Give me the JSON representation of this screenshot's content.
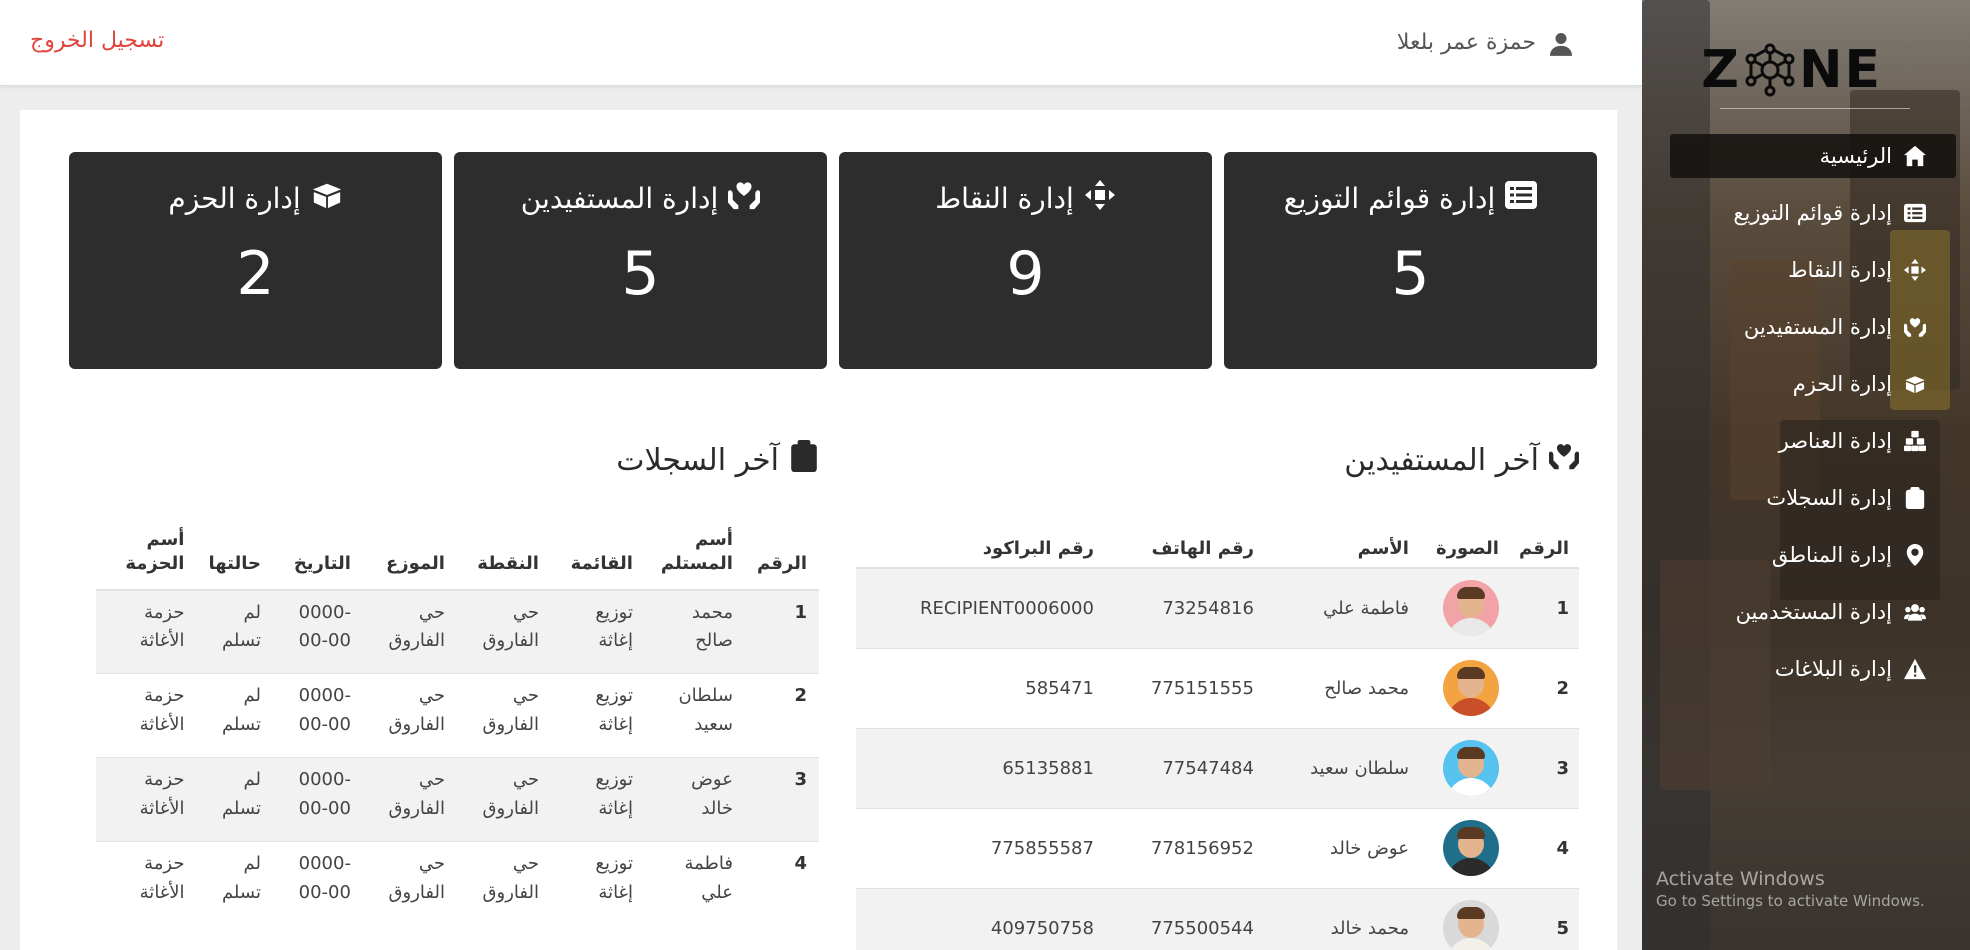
{
  "topbar": {
    "logout": "تسجيل الخروج",
    "user_name": "حمزة عمر بلعلا"
  },
  "sidebar": {
    "logo_left": "Z",
    "logo_right": "NE",
    "items": [
      {
        "label": "الرئيسية",
        "icon": "home-icon"
      },
      {
        "label": "إدارة قوائم التوزيع",
        "icon": "list-icon"
      },
      {
        "label": "إدارة النقاط",
        "icon": "points-icon"
      },
      {
        "label": "إدارة المستفيدين",
        "icon": "hands-icon"
      },
      {
        "label": "إدارة الحزم",
        "icon": "box-icon"
      },
      {
        "label": "إدارة العناصر",
        "icon": "items-icon"
      },
      {
        "label": "إدارة السجلات",
        "icon": "clipboard-icon"
      },
      {
        "label": "إدارة المناطق",
        "icon": "location-icon"
      },
      {
        "label": "إدارة المستخدمين",
        "icon": "users-icon"
      },
      {
        "label": "إدارة البلاغات",
        "icon": "warning-icon"
      }
    ]
  },
  "stats": [
    {
      "title": "إدارة قوائم التوزيع",
      "value": "5",
      "icon": "list-icon"
    },
    {
      "title": "إدارة النقاط",
      "value": "9",
      "icon": "points-icon"
    },
    {
      "title": "إدارة المستفيدين",
      "value": "5",
      "icon": "hands-icon"
    },
    {
      "title": "إدارة الحزم",
      "value": "2",
      "icon": "box-icon"
    }
  ],
  "beneficiaries": {
    "title": "آخر المستفيدين",
    "headers": [
      "الرقم",
      "الصورة",
      "الأسم",
      "رقم الهاتف",
      "رقم البراكود"
    ],
    "rows": [
      {
        "num": "1",
        "name": "فاطمة علي",
        "phone": "73254816",
        "barcode": "RECIPIENT0006000",
        "avatar_bg": "#f2a3a8",
        "shirt": "#e9e9e9"
      },
      {
        "num": "2",
        "name": "محمد صالح",
        "phone": "775151555",
        "barcode": "585471",
        "avatar_bg": "#f3a440",
        "shirt": "#c94f2a"
      },
      {
        "num": "3",
        "name": "سلطان سعيد",
        "phone": "77547484",
        "barcode": "65135881",
        "avatar_bg": "#56c3ef",
        "shirt": "#ffffff"
      },
      {
        "num": "4",
        "name": "عوض خالد",
        "phone": "778156952",
        "barcode": "775855587",
        "avatar_bg": "#1f6f8a",
        "shirt": "#2b2b2b"
      },
      {
        "num": "5",
        "name": "محمد خالد",
        "phone": "775500544",
        "barcode": "409750758",
        "avatar_bg": "#d9d9d9",
        "shirt": "#f3f0ea"
      }
    ]
  },
  "logs": {
    "title": "آخر السجلات",
    "headers": [
      "الرقم",
      "أسم المستلم",
      "القائمة",
      "النقطة",
      "الموزع",
      "التاريخ",
      "حالتها",
      "أسم الحزمة"
    ],
    "rows": [
      {
        "num": "1",
        "recipient": "محمد صالح",
        "list": "توزيع إغاثة",
        "point": "حي الفاروق",
        "distributor": "حي الفاروق",
        "date": "0000-00-00",
        "status": "لم تسلم",
        "package": "حزمة الأغاثة"
      },
      {
        "num": "2",
        "recipient": "سلطان سعيد",
        "list": "توزيع إغاثة",
        "point": "حي الفاروق",
        "distributor": "حي الفاروق",
        "date": "0000-00-00",
        "status": "لم تسلم",
        "package": "حزمة الأغاثة"
      },
      {
        "num": "3",
        "recipient": "عوض خالد",
        "list": "توزيع إغاثة",
        "point": "حي الفاروق",
        "distributor": "حي الفاروق",
        "date": "0000-00-00",
        "status": "لم تسلم",
        "package": "حزمة الأغاثة"
      },
      {
        "num": "4",
        "recipient": "فاطمة علي",
        "list": "توزيع إغاثة",
        "point": "حي الفاروق",
        "distributor": "حي الفاروق",
        "date": "0000-00-00",
        "status": "لم تسلم",
        "package": "حزمة الأغاثة"
      }
    ]
  },
  "watermark": {
    "line1": "Activate Windows",
    "line2": "Go to Settings to activate Windows."
  }
}
